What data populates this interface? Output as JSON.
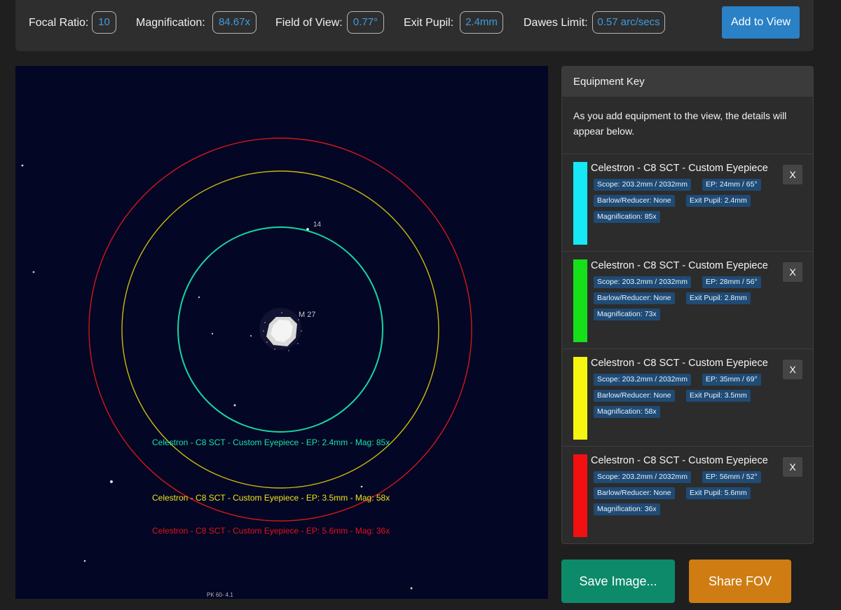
{
  "stats": {
    "focal_ratio_label": "Focal Ratio:",
    "focal_ratio_value": "10",
    "magnification_label": "Magnification:",
    "magnification_value": "84.67x",
    "fov_label": "Field of View:",
    "fov_value": "0.77°",
    "exit_pupil_label": "Exit Pupil:",
    "exit_pupil_value": "2.4mm",
    "dawes_label": "Dawes Limit:",
    "dawes_value": "0.57 arc/secs",
    "add_button": "Add to View"
  },
  "view": {
    "object_label": "M 27",
    "star_label_14": "14",
    "pk_label": "PK 60- 4.1",
    "ring_labels": [
      {
        "text": "Celestron - C8 SCT - Custom Eyepiece - EP: 2.4mm - Mag: 85x",
        "color": "#19e3a8"
      },
      {
        "text": "Celestron - C8 SCT - Custom Eyepiece - EP: 3.5mm - Mag: 58x",
        "color": "#f2e21a"
      },
      {
        "text": "Celestron - C8 SCT - Custom Eyepiece - EP: 5.6mm - Mag: 36x",
        "color": "#e0141a"
      }
    ],
    "ring_colors": {
      "inner": "#17d6a3",
      "middle": "#c9b80f",
      "outer": "#d01818"
    }
  },
  "equipment_key": {
    "title": "Equipment Key",
    "intro": "As you add equipment to the view, the details will appear below.",
    "remove_label": "X",
    "items": [
      {
        "color": "#17e8f5",
        "title": "Celestron - C8 SCT - Custom Eyepiece",
        "scope": "Scope: 203.2mm / 2032mm",
        "ep": "EP: 24mm / 65°",
        "barlow": "Barlow/Reducer: None",
        "exit_pupil": "Exit Pupil: 2.4mm",
        "magnification": "Magnification: 85x"
      },
      {
        "color": "#16e01a",
        "title": "Celestron - C8 SCT - Custom Eyepiece",
        "scope": "Scope: 203.2mm / 2032mm",
        "ep": "EP: 28mm / 56°",
        "barlow": "Barlow/Reducer: None",
        "exit_pupil": "Exit Pupil: 2.8mm",
        "magnification": "Magnification: 73x"
      },
      {
        "color": "#f5f50f",
        "title": "Celestron - C8 SCT - Custom Eyepiece",
        "scope": "Scope: 203.2mm / 2032mm",
        "ep": "EP: 35mm / 69°",
        "barlow": "Barlow/Reducer: None",
        "exit_pupil": "Exit Pupil: 3.5mm",
        "magnification": "Magnification: 58x"
      },
      {
        "color": "#f21010",
        "title": "Celestron - C8 SCT - Custom Eyepiece",
        "scope": "Scope: 203.2mm / 2032mm",
        "ep": "EP: 56mm / 52°",
        "barlow": "Barlow/Reducer: None",
        "exit_pupil": "Exit Pupil: 5.6mm",
        "magnification": "Magnification: 36x"
      }
    ]
  },
  "actions": {
    "save_button": "Save Image...",
    "share_button": "Share FOV"
  }
}
